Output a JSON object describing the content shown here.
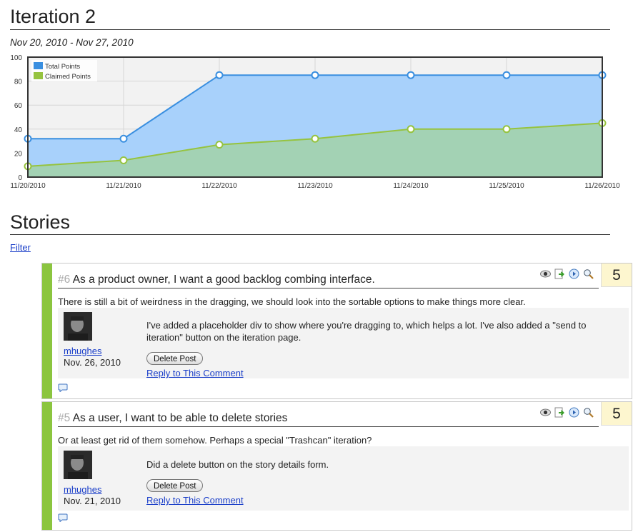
{
  "page": {
    "title": "Iteration 2",
    "date_range": "Nov 20, 2010 - Nov 27, 2010",
    "stories_heading": "Stories",
    "filter_label": "Filter"
  },
  "chart_data": {
    "type": "area",
    "x": [
      "11/20/2010",
      "11/21/2010",
      "11/22/2010",
      "11/23/2010",
      "11/24/2010",
      "11/25/2010",
      "11/26/2010"
    ],
    "series": [
      {
        "name": "Total Points",
        "values": [
          32,
          32,
          85,
          85,
          85,
          85,
          85
        ],
        "color": "#3a8fe0",
        "fill": "#a8d1fb"
      },
      {
        "name": "Claimed Points",
        "values": [
          9,
          14,
          27,
          32,
          40,
          40,
          45
        ],
        "color": "#96c33f",
        "fill": "#a2d2b0"
      }
    ],
    "ylim": [
      0,
      100
    ],
    "yticks": [
      "0",
      "20",
      "40",
      "60",
      "80",
      "100"
    ],
    "grid": true,
    "legend": "top-left",
    "title": "",
    "xlabel": "",
    "ylabel": ""
  },
  "stories": [
    {
      "number": "#6",
      "title": "As a product owner, I want a good backlog combing interface.",
      "points": "5",
      "description": "There is still a bit of weirdness in the dragging, we should look into the sortable options to make things more clear.",
      "comment": {
        "author": "mhughes",
        "date": "Nov. 26, 2010",
        "text": "I've added a placeholder div to show where you're dragging to, which helps a lot. I've also added a \"send to iteration\" button on the iteration page.",
        "delete_label": "Delete Post",
        "reply_label": "Reply to This Comment"
      }
    },
    {
      "number": "#5",
      "title": "As a user, I want to be able to delete stories",
      "points": "5",
      "description": "Or at least get rid of them somehow. Perhaps a special \"Trashcan\" iteration?",
      "comment": {
        "author": "mhughes",
        "date": "Nov. 21, 2010",
        "text": "Did a delete button on the story details form.",
        "delete_label": "Delete Post",
        "reply_label": "Reply to This Comment"
      }
    }
  ],
  "icons": [
    "eye-icon",
    "send-to-iteration-icon",
    "next-icon",
    "zoom-icon",
    "comment-bubble-icon"
  ]
}
